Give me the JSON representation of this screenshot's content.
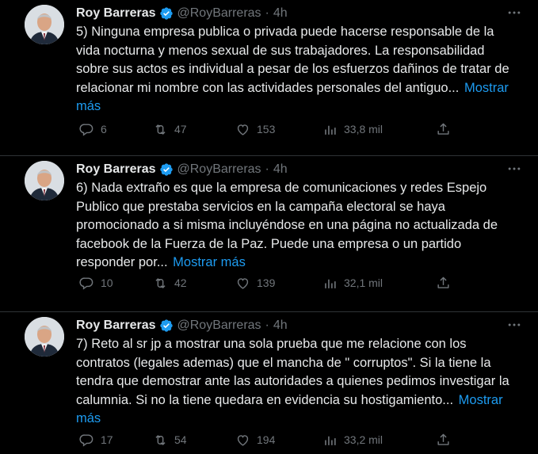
{
  "colors": {
    "background": "#000000",
    "text": "#e7e9ea",
    "muted": "#71767b",
    "link": "#1d9bf0",
    "verified": "#1d9bf0",
    "divider": "#2f3336"
  },
  "tweets": [
    {
      "author_name": "Roy Barreras",
      "handle": "@RoyBarreras",
      "separator": "·",
      "time": "4h",
      "more_icon": "ellipsis-icon",
      "text": "5) Ninguna empresa publica o privada puede hacerse responsable de la vida nocturna y menos sexual de sus trabajadores. La responsabilidad sobre sus actos es individual a pesar de los esfuerzos dañinos de tratar de relacionar mi nombre con las actividades personales del antiguo...",
      "show_more": "Mostrar más",
      "replies": "6",
      "retweets": "47",
      "likes": "153",
      "views": "33,8 mil"
    },
    {
      "author_name": "Roy Barreras",
      "handle": "@RoyBarreras",
      "separator": "·",
      "time": "4h",
      "more_icon": "ellipsis-icon",
      "text": "6) Nada extraño es que la empresa de comunicaciones y redes Espejo Publico que prestaba servicios en la campaña electoral se haya promocionado a si misma incluyéndose en una página no actualizada de facebook de la Fuerza de la Paz. Puede una empresa o un partido responder por...",
      "show_more": "Mostrar más",
      "replies": "10",
      "retweets": "42",
      "likes": "139",
      "views": "32,1 mil"
    },
    {
      "author_name": "Roy Barreras",
      "handle": "@RoyBarreras",
      "separator": "·",
      "time": "4h",
      "more_icon": "ellipsis-icon",
      "text": "7) Reto al sr jp a mostrar una sola prueba que me relacione con los contratos (legales ademas) que el mancha de \" corruptos\". Si la tiene la tendra que demostrar ante las autoridades a quienes pedimos investigar la calumnia. Si no la tiene quedara en evidencia su hostigamiento...",
      "show_more": "Mostrar más",
      "replies": "17",
      "retweets": "54",
      "likes": "194",
      "views": "33,2 mil"
    }
  ]
}
